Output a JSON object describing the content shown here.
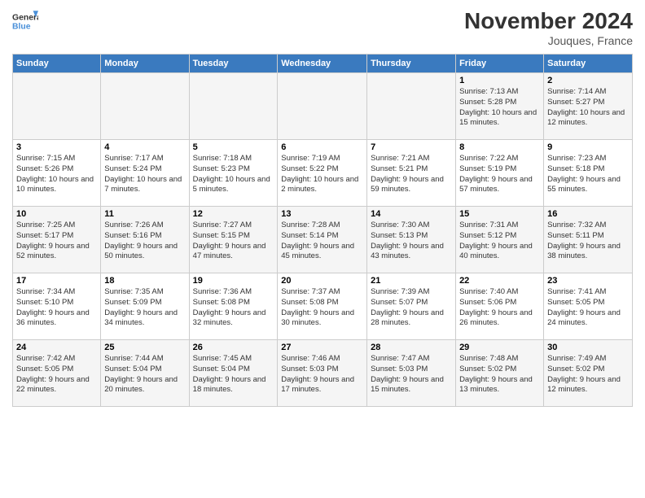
{
  "header": {
    "logo_line1": "General",
    "logo_line2": "Blue",
    "month": "November 2024",
    "location": "Jouques, France"
  },
  "weekdays": [
    "Sunday",
    "Monday",
    "Tuesday",
    "Wednesday",
    "Thursday",
    "Friday",
    "Saturday"
  ],
  "weeks": [
    [
      {
        "day": "",
        "info": ""
      },
      {
        "day": "",
        "info": ""
      },
      {
        "day": "",
        "info": ""
      },
      {
        "day": "",
        "info": ""
      },
      {
        "day": "",
        "info": ""
      },
      {
        "day": "1",
        "info": "Sunrise: 7:13 AM\nSunset: 5:28 PM\nDaylight: 10 hours and 15 minutes."
      },
      {
        "day": "2",
        "info": "Sunrise: 7:14 AM\nSunset: 5:27 PM\nDaylight: 10 hours and 12 minutes."
      }
    ],
    [
      {
        "day": "3",
        "info": "Sunrise: 7:15 AM\nSunset: 5:26 PM\nDaylight: 10 hours and 10 minutes."
      },
      {
        "day": "4",
        "info": "Sunrise: 7:17 AM\nSunset: 5:24 PM\nDaylight: 10 hours and 7 minutes."
      },
      {
        "day": "5",
        "info": "Sunrise: 7:18 AM\nSunset: 5:23 PM\nDaylight: 10 hours and 5 minutes."
      },
      {
        "day": "6",
        "info": "Sunrise: 7:19 AM\nSunset: 5:22 PM\nDaylight: 10 hours and 2 minutes."
      },
      {
        "day": "7",
        "info": "Sunrise: 7:21 AM\nSunset: 5:21 PM\nDaylight: 9 hours and 59 minutes."
      },
      {
        "day": "8",
        "info": "Sunrise: 7:22 AM\nSunset: 5:19 PM\nDaylight: 9 hours and 57 minutes."
      },
      {
        "day": "9",
        "info": "Sunrise: 7:23 AM\nSunset: 5:18 PM\nDaylight: 9 hours and 55 minutes."
      }
    ],
    [
      {
        "day": "10",
        "info": "Sunrise: 7:25 AM\nSunset: 5:17 PM\nDaylight: 9 hours and 52 minutes."
      },
      {
        "day": "11",
        "info": "Sunrise: 7:26 AM\nSunset: 5:16 PM\nDaylight: 9 hours and 50 minutes."
      },
      {
        "day": "12",
        "info": "Sunrise: 7:27 AM\nSunset: 5:15 PM\nDaylight: 9 hours and 47 minutes."
      },
      {
        "day": "13",
        "info": "Sunrise: 7:28 AM\nSunset: 5:14 PM\nDaylight: 9 hours and 45 minutes."
      },
      {
        "day": "14",
        "info": "Sunrise: 7:30 AM\nSunset: 5:13 PM\nDaylight: 9 hours and 43 minutes."
      },
      {
        "day": "15",
        "info": "Sunrise: 7:31 AM\nSunset: 5:12 PM\nDaylight: 9 hours and 40 minutes."
      },
      {
        "day": "16",
        "info": "Sunrise: 7:32 AM\nSunset: 5:11 PM\nDaylight: 9 hours and 38 minutes."
      }
    ],
    [
      {
        "day": "17",
        "info": "Sunrise: 7:34 AM\nSunset: 5:10 PM\nDaylight: 9 hours and 36 minutes."
      },
      {
        "day": "18",
        "info": "Sunrise: 7:35 AM\nSunset: 5:09 PM\nDaylight: 9 hours and 34 minutes."
      },
      {
        "day": "19",
        "info": "Sunrise: 7:36 AM\nSunset: 5:08 PM\nDaylight: 9 hours and 32 minutes."
      },
      {
        "day": "20",
        "info": "Sunrise: 7:37 AM\nSunset: 5:08 PM\nDaylight: 9 hours and 30 minutes."
      },
      {
        "day": "21",
        "info": "Sunrise: 7:39 AM\nSunset: 5:07 PM\nDaylight: 9 hours and 28 minutes."
      },
      {
        "day": "22",
        "info": "Sunrise: 7:40 AM\nSunset: 5:06 PM\nDaylight: 9 hours and 26 minutes."
      },
      {
        "day": "23",
        "info": "Sunrise: 7:41 AM\nSunset: 5:05 PM\nDaylight: 9 hours and 24 minutes."
      }
    ],
    [
      {
        "day": "24",
        "info": "Sunrise: 7:42 AM\nSunset: 5:05 PM\nDaylight: 9 hours and 22 minutes."
      },
      {
        "day": "25",
        "info": "Sunrise: 7:44 AM\nSunset: 5:04 PM\nDaylight: 9 hours and 20 minutes."
      },
      {
        "day": "26",
        "info": "Sunrise: 7:45 AM\nSunset: 5:04 PM\nDaylight: 9 hours and 18 minutes."
      },
      {
        "day": "27",
        "info": "Sunrise: 7:46 AM\nSunset: 5:03 PM\nDaylight: 9 hours and 17 minutes."
      },
      {
        "day": "28",
        "info": "Sunrise: 7:47 AM\nSunset: 5:03 PM\nDaylight: 9 hours and 15 minutes."
      },
      {
        "day": "29",
        "info": "Sunrise: 7:48 AM\nSunset: 5:02 PM\nDaylight: 9 hours and 13 minutes."
      },
      {
        "day": "30",
        "info": "Sunrise: 7:49 AM\nSunset: 5:02 PM\nDaylight: 9 hours and 12 minutes."
      }
    ]
  ]
}
